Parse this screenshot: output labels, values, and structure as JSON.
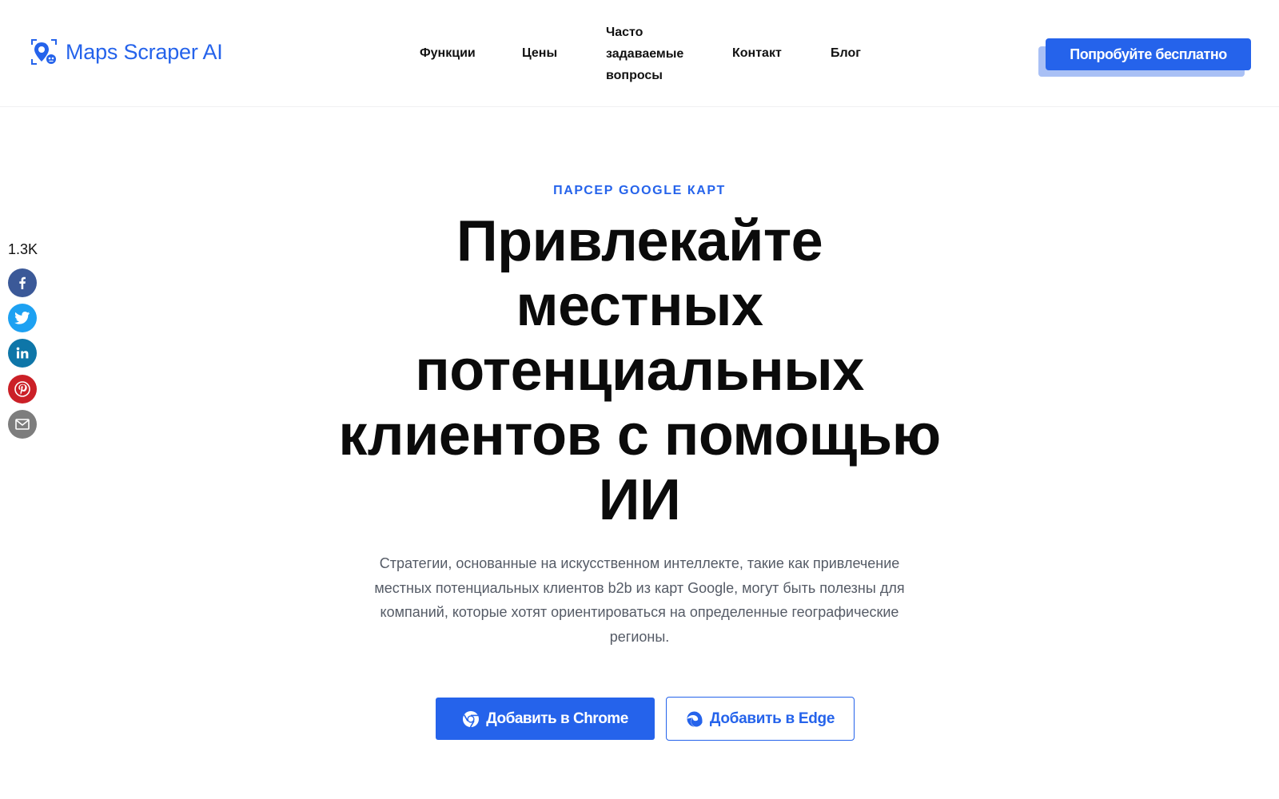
{
  "brand": {
    "name": "Maps Scraper AI",
    "color": "#2563eb",
    "icon": "map-pin-scan-icon"
  },
  "nav": {
    "items": [
      {
        "label": "Функции"
      },
      {
        "label": "Цены"
      },
      {
        "label": "Часто задаваемые вопросы"
      },
      {
        "label": "Контакт"
      },
      {
        "label": "Блог"
      }
    ],
    "cta_label": "Попробуйте бесплатно"
  },
  "share": {
    "count": "1.3K",
    "buttons": [
      {
        "network": "facebook",
        "icon": "facebook-icon",
        "color": "#3b5998"
      },
      {
        "network": "twitter",
        "icon": "twitter-icon",
        "color": "#1da1f2"
      },
      {
        "network": "linkedin",
        "icon": "linkedin-icon",
        "color": "#0e76a8"
      },
      {
        "network": "pinterest",
        "icon": "pinterest-icon",
        "color": "#cb2027"
      },
      {
        "network": "email",
        "icon": "email-icon",
        "color": "#7d7d7d"
      }
    ]
  },
  "hero": {
    "eyebrow": "ПАРСЕР GOOGLE КАРТ",
    "title": "Привлекайте местных потенциальных клиентов с помощью ИИ",
    "description": "Стратегии, основанные на искусственном интеллекте, такие как привлечение местных потенциальных клиентов b2b из карт Google, могут быть полезны для компаний, которые хотят ориентироваться на определенные географические регионы.",
    "buttons": {
      "chrome": {
        "label": "Добавить в Chrome",
        "icon": "chrome-icon"
      },
      "edge": {
        "label": "Добавить в Edge",
        "icon": "edge-icon"
      }
    }
  },
  "colors": {
    "accent": "#2563eb",
    "accent_shadow": "#a9c0f5",
    "text": "#0b0b0b",
    "muted": "#555b66"
  }
}
